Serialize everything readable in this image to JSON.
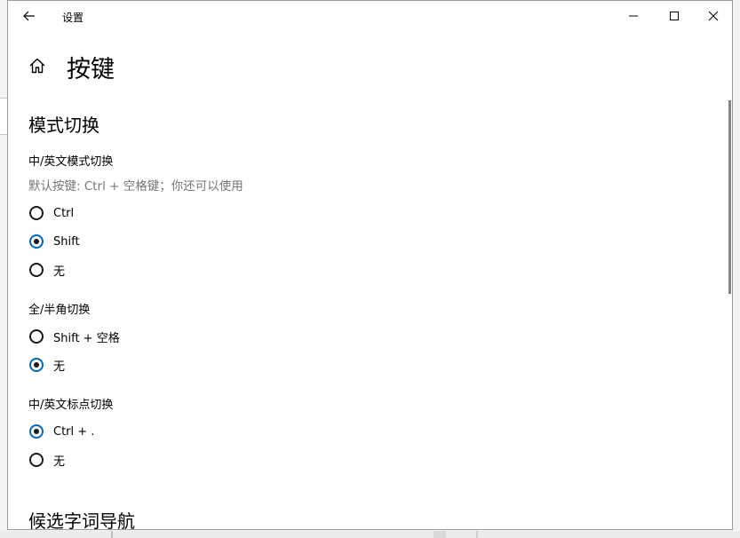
{
  "window": {
    "title": "设置"
  },
  "page": {
    "title": "按键"
  },
  "sections": {
    "mode_switch": {
      "title": "模式切换",
      "cn_en_switch": {
        "label": "中/英文模式切换",
        "hint": "默认按键: Ctrl + 空格键；你还可以使用",
        "options": [
          "Ctrl",
          "Shift",
          "无"
        ],
        "selected": "Shift"
      },
      "full_half_switch": {
        "label": "全/半角切换",
        "options": [
          "Shift + 空格",
          "无"
        ],
        "selected": "无"
      },
      "punct_switch": {
        "label": "中/英文标点切换",
        "options": [
          "Ctrl + .",
          "无"
        ],
        "selected": "Ctrl + ."
      }
    },
    "candidate_nav": {
      "title": "候选字词导航"
    }
  },
  "icons": {
    "back": "back-arrow-icon",
    "home": "home-icon",
    "minimize": "minimize-icon",
    "maximize": "maximize-icon",
    "close": "close-icon"
  },
  "colors": {
    "accent": "#0067c0",
    "hint_text": "#767676"
  }
}
